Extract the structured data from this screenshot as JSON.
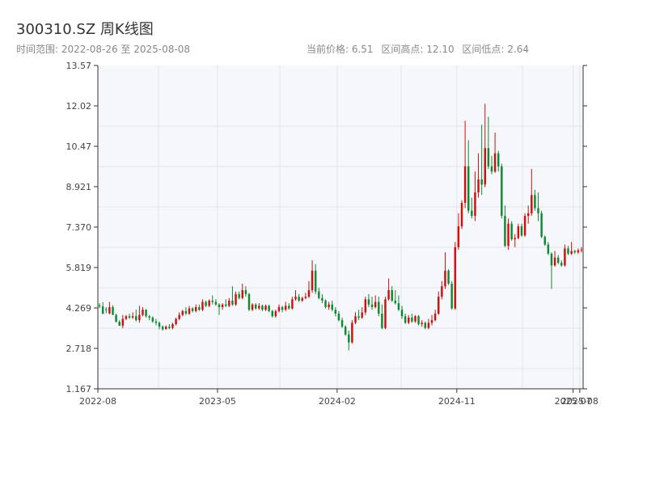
{
  "header": {
    "title": "300310.SZ 周K线图",
    "range_text": "时间范围: 2022-08-26 至 2025-08-08",
    "current_price_text": "当前价格: 6.51",
    "high_text": "区间高点: 12.10",
    "low_text": "区间低点: 2.64"
  },
  "colors": {
    "up": "#cc1111",
    "down": "#118833",
    "plot_bg": "#f6f7fa",
    "grid": "#e3e5ea",
    "axis": "#333333"
  },
  "chart_data": {
    "type": "candlestick",
    "ylim": [
      1.167,
      13.57
    ],
    "y_ticks": [
      "1.167",
      "2.718",
      "4.269",
      "5.819",
      "7.370",
      "8.921",
      "10.47",
      "12.02",
      "13.57"
    ],
    "x_ticks": [
      "2022-08",
      "2023-05",
      "2024-02",
      "2024-11",
      "2025-07",
      "2025-08"
    ],
    "x_tick_weeks": [
      0,
      36,
      72,
      108,
      143,
      145
    ],
    "candles": [
      [
        4.37,
        4.45,
        4.33,
        4.26
      ],
      [
        4.33,
        4.49,
        4.04,
        4.22
      ],
      [
        4.22,
        4.3,
        4.2,
        4.06
      ],
      [
        4.06,
        4.5,
        4.3,
        4.03
      ],
      [
        4.3,
        4.37,
        4.0,
        4.0
      ],
      [
        4.0,
        4.05,
        3.74,
        3.71
      ],
      [
        3.74,
        3.8,
        3.59,
        3.58
      ],
      [
        3.59,
        4.0,
        3.85,
        3.49
      ],
      [
        3.85,
        4.0,
        3.95,
        3.8
      ],
      [
        3.95,
        4.05,
        3.9,
        3.85
      ],
      [
        3.9,
        4.1,
        3.95,
        3.85
      ],
      [
        3.95,
        4.2,
        3.8,
        3.75
      ],
      [
        3.8,
        4.35,
        4.0,
        3.7
      ],
      [
        4.0,
        4.3,
        4.2,
        3.95
      ],
      [
        4.2,
        4.22,
        3.95,
        3.9
      ],
      [
        3.95,
        4.0,
        3.9,
        3.8
      ],
      [
        3.9,
        3.95,
        3.75,
        3.7
      ],
      [
        3.75,
        3.85,
        3.7,
        3.6
      ],
      [
        3.7,
        3.75,
        3.55,
        3.45
      ],
      [
        3.55,
        3.6,
        3.45,
        3.4
      ],
      [
        3.45,
        3.6,
        3.55,
        3.45
      ],
      [
        3.55,
        3.65,
        3.5,
        3.45
      ],
      [
        3.5,
        3.7,
        3.65,
        3.45
      ],
      [
        3.65,
        3.9,
        3.85,
        3.6
      ],
      [
        3.85,
        4.1,
        4.0,
        3.8
      ],
      [
        4.0,
        4.2,
        4.15,
        3.95
      ],
      [
        4.15,
        4.3,
        4.05,
        4.0
      ],
      [
        4.05,
        4.35,
        4.25,
        4.0
      ],
      [
        4.25,
        4.3,
        4.15,
        4.1
      ],
      [
        4.15,
        4.4,
        4.3,
        4.1
      ],
      [
        4.3,
        4.4,
        4.2,
        4.15
      ],
      [
        4.2,
        4.6,
        4.5,
        4.15
      ],
      [
        4.5,
        4.55,
        4.35,
        4.3
      ],
      [
        4.35,
        4.6,
        4.55,
        4.3
      ],
      [
        4.55,
        4.75,
        4.5,
        4.4
      ],
      [
        4.5,
        4.6,
        4.4,
        4.35
      ],
      [
        4.4,
        4.45,
        4.3,
        4.0
      ],
      [
        4.3,
        4.45,
        4.4,
        4.2
      ],
      [
        4.4,
        4.6,
        4.35,
        4.3
      ],
      [
        4.35,
        4.65,
        4.55,
        4.3
      ],
      [
        4.55,
        5.1,
        4.4,
        4.35
      ],
      [
        4.4,
        4.9,
        4.8,
        4.35
      ],
      [
        4.8,
        4.9,
        4.65,
        4.6
      ],
      [
        4.65,
        5.2,
        4.95,
        4.6
      ],
      [
        4.95,
        5.1,
        4.8,
        4.7
      ],
      [
        4.8,
        4.85,
        4.2,
        4.15
      ],
      [
        4.2,
        4.45,
        4.4,
        4.15
      ],
      [
        4.4,
        4.45,
        4.25,
        4.2
      ],
      [
        4.25,
        4.45,
        4.35,
        4.2
      ],
      [
        4.35,
        4.4,
        4.2,
        4.15
      ],
      [
        4.2,
        4.4,
        4.35,
        4.15
      ],
      [
        4.35,
        4.4,
        4.15,
        4.1
      ],
      [
        4.15,
        4.2,
        3.95,
        3.9
      ],
      [
        3.95,
        4.2,
        4.15,
        3.9
      ],
      [
        4.15,
        4.4,
        4.3,
        4.1
      ],
      [
        4.3,
        4.35,
        4.2,
        4.1
      ],
      [
        4.2,
        4.5,
        4.35,
        4.15
      ],
      [
        4.35,
        4.45,
        4.25,
        4.2
      ],
      [
        4.25,
        4.7,
        4.6,
        4.2
      ],
      [
        4.6,
        4.95,
        4.7,
        4.55
      ],
      [
        4.7,
        4.8,
        4.55,
        4.5
      ],
      [
        4.55,
        4.7,
        4.65,
        4.5
      ],
      [
        4.65,
        4.85,
        4.7,
        4.6
      ],
      [
        4.7,
        5.3,
        4.95,
        4.65
      ],
      [
        4.95,
        6.1,
        5.7,
        4.85
      ],
      [
        5.7,
        5.95,
        4.9,
        4.8
      ],
      [
        4.9,
        5.05,
        4.65,
        4.6
      ],
      [
        4.65,
        4.8,
        4.55,
        4.45
      ],
      [
        4.55,
        4.6,
        4.3,
        4.25
      ],
      [
        4.3,
        4.5,
        4.4,
        4.2
      ],
      [
        4.4,
        4.55,
        4.2,
        4.15
      ],
      [
        4.2,
        4.3,
        4.05,
        3.95
      ],
      [
        4.05,
        4.15,
        3.8,
        3.75
      ],
      [
        3.8,
        3.9,
        3.55,
        3.5
      ],
      [
        3.55,
        3.6,
        3.25,
        3.2
      ],
      [
        3.25,
        3.4,
        2.95,
        2.64
      ],
      [
        2.95,
        3.8,
        3.7,
        2.9
      ],
      [
        3.7,
        4.1,
        3.95,
        3.65
      ],
      [
        3.95,
        4.2,
        3.9,
        3.8
      ],
      [
        3.9,
        4.3,
        4.1,
        3.85
      ],
      [
        4.1,
        4.7,
        4.6,
        4.0
      ],
      [
        4.6,
        4.8,
        4.4,
        4.3
      ],
      [
        4.4,
        4.7,
        4.3,
        4.2
      ],
      [
        4.3,
        4.75,
        4.5,
        4.25
      ],
      [
        4.5,
        4.7,
        4.05,
        3.95
      ],
      [
        4.05,
        4.4,
        3.5,
        3.45
      ],
      [
        3.5,
        4.7,
        4.6,
        3.45
      ],
      [
        4.6,
        5.4,
        4.95,
        4.55
      ],
      [
        4.95,
        5.1,
        4.55,
        4.5
      ],
      [
        4.55,
        4.95,
        4.45,
        4.4
      ],
      [
        4.45,
        4.75,
        4.2,
        4.15
      ],
      [
        4.2,
        4.35,
        3.95,
        3.85
      ],
      [
        3.95,
        4.05,
        3.7,
        3.65
      ],
      [
        3.7,
        4.0,
        3.9,
        3.65
      ],
      [
        3.9,
        4.05,
        3.75,
        3.7
      ],
      [
        3.75,
        4.0,
        3.95,
        3.7
      ],
      [
        3.95,
        4.0,
        3.65,
        3.6
      ],
      [
        3.65,
        3.8,
        3.7,
        3.55
      ],
      [
        3.7,
        3.75,
        3.5,
        3.45
      ],
      [
        3.5,
        3.85,
        3.7,
        3.45
      ],
      [
        3.7,
        4.0,
        3.8,
        3.6
      ],
      [
        3.8,
        4.2,
        4.05,
        3.75
      ],
      [
        4.05,
        4.9,
        4.7,
        4.0
      ],
      [
        4.7,
        5.3,
        5.1,
        4.6
      ],
      [
        5.1,
        6.4,
        5.7,
        5.0
      ],
      [
        5.7,
        5.75,
        5.2,
        5.15
      ],
      [
        5.2,
        5.3,
        4.25,
        4.2
      ],
      [
        4.25,
        6.8,
        6.6,
        4.2
      ],
      [
        6.6,
        7.9,
        7.4,
        6.5
      ],
      [
        7.4,
        8.4,
        8.3,
        7.3
      ],
      [
        8.3,
        11.45,
        9.7,
        8.1
      ],
      [
        9.7,
        10.7,
        8.0,
        7.9
      ],
      [
        8.0,
        8.5,
        7.8,
        7.7
      ],
      [
        7.8,
        9.5,
        8.7,
        7.6
      ],
      [
        8.7,
        10.2,
        9.2,
        8.5
      ],
      [
        9.2,
        11.3,
        9.0,
        8.6
      ],
      [
        9.0,
        12.1,
        10.4,
        8.9
      ],
      [
        10.4,
        11.6,
        9.7,
        9.6
      ],
      [
        9.7,
        10.1,
        9.5,
        9.4
      ],
      [
        9.5,
        11.0,
        10.2,
        9.45
      ],
      [
        10.2,
        10.3,
        9.7,
        9.5
      ],
      [
        9.7,
        9.8,
        7.8,
        7.7
      ],
      [
        7.8,
        8.2,
        6.65,
        6.6
      ],
      [
        6.65,
        7.7,
        7.5,
        6.5
      ],
      [
        7.5,
        7.6,
        6.9,
        6.85
      ],
      [
        6.9,
        7.1,
        6.95,
        6.6
      ],
      [
        6.95,
        7.5,
        7.4,
        6.9
      ],
      [
        7.4,
        7.5,
        7.05,
        7.0
      ],
      [
        7.05,
        7.9,
        7.8,
        7.0
      ],
      [
        7.8,
        8.2,
        7.9,
        7.5
      ],
      [
        7.9,
        9.6,
        8.6,
        7.8
      ],
      [
        8.6,
        8.8,
        8.1,
        8.0
      ],
      [
        8.1,
        8.7,
        7.9,
        7.6
      ],
      [
        7.9,
        8.0,
        7.0,
        6.95
      ],
      [
        7.0,
        7.05,
        6.7,
        6.65
      ],
      [
        6.7,
        6.8,
        6.35,
        6.3
      ],
      [
        6.35,
        6.4,
        5.9,
        5.0
      ],
      [
        5.9,
        6.45,
        6.2,
        5.85
      ],
      [
        6.2,
        6.3,
        6.0,
        5.95
      ],
      [
        6.0,
        6.1,
        5.9,
        5.85
      ],
      [
        5.9,
        6.7,
        6.55,
        5.85
      ],
      [
        6.55,
        6.65,
        6.35,
        6.3
      ],
      [
        6.35,
        6.8,
        6.45,
        6.3
      ],
      [
        6.45,
        6.5,
        6.4,
        6.35
      ],
      [
        6.4,
        6.55,
        6.48,
        6.35
      ],
      [
        6.48,
        6.6,
        6.51,
        6.4
      ]
    ]
  }
}
